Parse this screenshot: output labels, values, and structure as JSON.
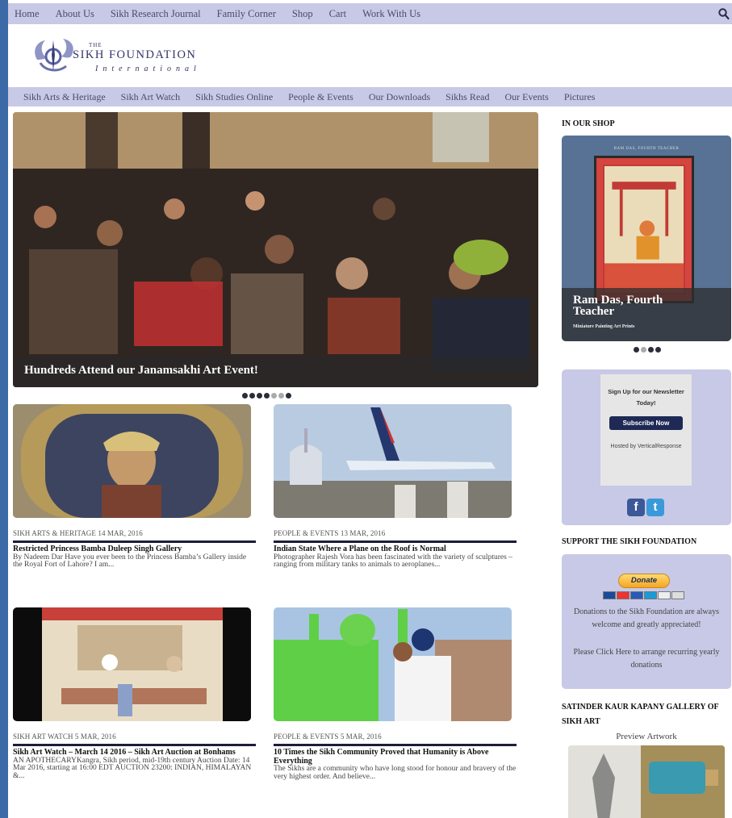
{
  "topnav": {
    "items": [
      "Home",
      "About Us",
      "Sikh Research Journal",
      "Family Corner",
      "Shop",
      "Cart",
      "Work With Us"
    ],
    "search_icon": "search-icon"
  },
  "logo": {
    "the": "THE",
    "name": "SIKH FOUNDATION",
    "intl": "International"
  },
  "mainnav": {
    "items": [
      "Sikh Arts & Heritage",
      "Sikh Art Watch",
      "Sikh Studies Online",
      "People & Events",
      "Our Downloads",
      "Sikhs Read",
      "Our Events",
      "Pictures"
    ]
  },
  "slider": {
    "caption": "Hundreds Attend our Janamsakhi Art Event!",
    "dots": [
      true,
      true,
      true,
      true,
      false,
      false,
      true
    ]
  },
  "articles": [
    {
      "meta": "SIKH ARTS & HERITAGE  14 MAR, 2016",
      "title": "Restricted Princess Bamba Duleep Singh Gallery",
      "excerpt": "By Nadeem Dar Have you ever been to the Princess Bamba’s Gallery inside the Royal Fort of Lahore? I am..."
    },
    {
      "meta": "PEOPLE & EVENTS  13 MAR, 2016",
      "title": "Indian State Where a Plane on the Roof is Normal",
      "excerpt": "Photographer Rajesh Vora has been fascinated with the variety of sculptures – ranging from military tanks to animals to aeroplanes..."
    },
    {
      "meta": "SIKH ART WATCH  5 MAR, 2016",
      "title": "Sikh Art Watch – March 14 2016 – Sikh Art Auction at Bonhams",
      "excerpt": "AN APOTHECARYKangra, Sikh period, mid-19th century Auction Date: 14 Mar 2016, starting at 16:00 EDT AUCTION 23200: INDIAN, HIMALAYAN &..."
    },
    {
      "meta": "PEOPLE & EVENTS  5 MAR, 2016",
      "title": "10 Times the Sikh Community Proved that Humanity is Above Everything",
      "excerpt": "The Sikhs are a community who have long stood for honour and bravery of the very highest order. And believe..."
    }
  ],
  "sidebar": {
    "shop_heading": "IN OUR SHOP",
    "shop_book_top": "RAM DAS, FOURTH TEACHER",
    "shop_title": "Ram Das, Fourth Teacher",
    "shop_subtitle": "Miniature Painting Art Prints",
    "shop_dots": [
      true,
      false,
      true,
      true
    ],
    "newsletter_heading": "Sign Up for our Newsletter Today!",
    "subscribe_label": "Subscribe Now",
    "hosted_by": "Hosted by VerticalResponse",
    "support_heading": "SUPPORT THE SIKH FOUNDATION",
    "donate_label": "Donate",
    "support_text": "Donations to the Sikh Foundation are always welcome and greatly appreciated!",
    "support_text2": "Please Click Here to arrange recurring yearly donations",
    "gallery_heading": "SATINDER KAUR KAPANY GALLERY OF SIKH ART",
    "preview_label": "Preview Artwork"
  },
  "colors": {
    "nav_bg": "#c8c9e6",
    "page_border": "#3b6aa6",
    "rule": "#1c1c3a",
    "subscribe_bg": "#1e2a55"
  }
}
